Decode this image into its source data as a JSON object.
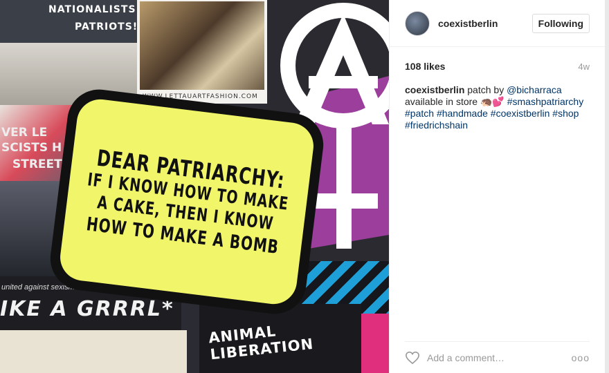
{
  "photo": {
    "sticker_top": [
      "NATIONALISTS",
      "PATRIOTS!"
    ],
    "website": "WWW.LETTAUARTFASHION.COM",
    "left_sticker": [
      "VER LE",
      "SCISTS H",
      "STREET"
    ],
    "patch_lines": [
      "DEAR PATRIARCHY:",
      "IF I KNOW HOW TO MAKE",
      "A CAKE, THEN I KNOW",
      "HOW TO MAKE A BOMB"
    ],
    "united_text": "united against sexism & fascism",
    "grrrl_text": "IKE A GRRRL*",
    "animal_text": "ANIMAL LIBERATION"
  },
  "header": {
    "username": "coexistberlin",
    "follow_label": "Following"
  },
  "meta": {
    "likes": "108 likes",
    "time": "4w"
  },
  "caption": {
    "author": "coexistberlin",
    "text1": " patch by ",
    "mention": "@bicharraca",
    "text2": "available in store 🦔💕 ",
    "tags": {
      "t1": "#smashpatriarchy",
      "t2": "#patch",
      "t3": "#handmade",
      "t4": "#coexistberlin",
      "t5": "#shop",
      "t6": "#friedrichshain"
    }
  },
  "comment": {
    "placeholder": "Add a comment…",
    "more": "ooo"
  }
}
